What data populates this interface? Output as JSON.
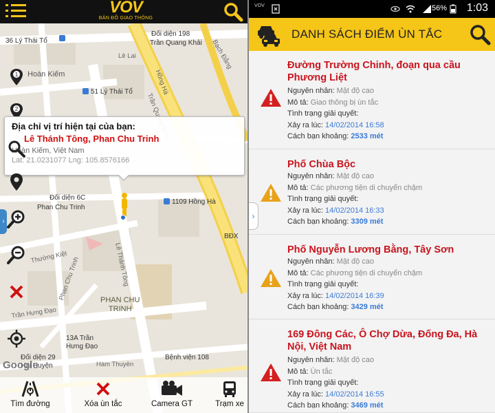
{
  "left": {
    "logo": {
      "mark": "VOV",
      "sub": "BẢN ĐỒ GIAO THÔNG"
    },
    "map_labels": [
      {
        "id": "lythaito36",
        "text": "36 Lý Thái Tổ"
      },
      {
        "id": "doidien198",
        "text": "Đối diện 198"
      },
      {
        "id": "tranquangkhai",
        "text": "Trần Quang Khải"
      },
      {
        "id": "lelai",
        "text": "Lê Lai"
      },
      {
        "id": "bachdang",
        "text": "Bạch Đằng"
      },
      {
        "id": "hoankiem",
        "text": "Hoàn Kiếm"
      },
      {
        "id": "lythaito51",
        "text": "51 Lý Thái Tổ"
      },
      {
        "id": "honggai",
        "text": "Hồng Hà"
      },
      {
        "id": "tranquangkhai2",
        "text": "Trần Quang Khải"
      },
      {
        "id": "doidien6c",
        "text": "Đối diện 6C"
      },
      {
        "id": "phanchutrinh",
        "text": "Phan Chu Trinh"
      },
      {
        "id": "honghq1109",
        "text": "1109 Hồng Hà"
      },
      {
        "id": "bdx",
        "text": "BĐX"
      },
      {
        "id": "thuongkiet",
        "text": "Thường Kiệt"
      },
      {
        "id": "phanchutrinhrd",
        "text": "Phan Chu Trinh"
      },
      {
        "id": "lethanhtong",
        "text": "Lê Thánh Tông"
      },
      {
        "id": "district",
        "text": "PHAN CHU\nTRINH"
      },
      {
        "id": "tranhungdao",
        "text": "Trần Hưng Đạo"
      },
      {
        "id": "tran13a",
        "text": "13A Trần\nHưng Đạo"
      },
      {
        "id": "doidien29",
        "text": "Đối diện 29\nHai Huyện"
      },
      {
        "id": "hamthuyen",
        "text": "Hàm Thuyên"
      },
      {
        "id": "benhvien108",
        "text": "Bệnh viện 108"
      }
    ],
    "popup": {
      "title": "Địa chỉ vị trí hiện tại của bạn:",
      "street": "Lê Thánh Tông, Phan Chu Trinh",
      "city": "Hoàn Kiếm, Việt Nam",
      "coords": "Lat: 21.0231077 Lng: 105.8576166"
    },
    "tools": [
      "pin-1-icon",
      "pin-2-icon",
      "search-zoom-icon",
      "location-pin-icon",
      "zoom-in-icon",
      "zoom-out-icon",
      "close-x-icon",
      "gps-target-icon"
    ],
    "google": "Google",
    "bottom_tabs": [
      {
        "label": "Tìm đường",
        "icon": "road-icon"
      },
      {
        "label": "Xóa ùn tắc",
        "icon": "clear-x-icon"
      },
      {
        "label": "Camera GT",
        "icon": "camera-icon"
      },
      {
        "label": "Trạm xe",
        "icon": "bus-icon"
      }
    ]
  },
  "right": {
    "status": {
      "carrier": "VOV",
      "battery": "56%",
      "time": "1:03"
    },
    "header_title": "DANH SÁCH ĐIỂM ÙN TẮC",
    "labels": {
      "cause": "Nguyên nhân:",
      "desc": "Mô tả:",
      "state": "Tình trạng giải quyết:",
      "time": "Xảy ra lúc:",
      "dist": "Cách bạn khoảng:"
    },
    "items": [
      {
        "name": "Đường Trường Chinh, đoạn qua cầu Phương Liệt",
        "cause": "Mật độ cao",
        "desc": "Giao thông bị ùn tắc",
        "state": "",
        "time": "14/02/2014 16:58",
        "dist": "2533 mét",
        "severity": "red"
      },
      {
        "name": "Phố Chùa Bộc",
        "cause": "Mật độ cao",
        "desc": "Các phương tiện di chuyển chậm",
        "state": "",
        "time": "14/02/2014 16:33",
        "dist": "3309 mét",
        "severity": "orange"
      },
      {
        "name": "Phố Nguyễn Lương Bằng, Tây Sơn",
        "cause": "Mật độ cao",
        "desc": "Các phương tiện di chuyển chậm",
        "state": "",
        "time": "14/02/2014 16:39",
        "dist": "3429 mét",
        "severity": "orange"
      },
      {
        "name": "169 Đông Các, Ô Chợ Dừa, Đống Đa, Hà Nội, Việt Nam",
        "cause": "Mật độ cao",
        "desc": "Ùn tắc",
        "state": "",
        "time": "14/02/2014 16:55",
        "dist": "3469 mét",
        "severity": "red"
      }
    ],
    "colors": {
      "accent": "#f5c518",
      "alert_red": "#c8141e",
      "link_blue": "#3a7bd5"
    }
  }
}
